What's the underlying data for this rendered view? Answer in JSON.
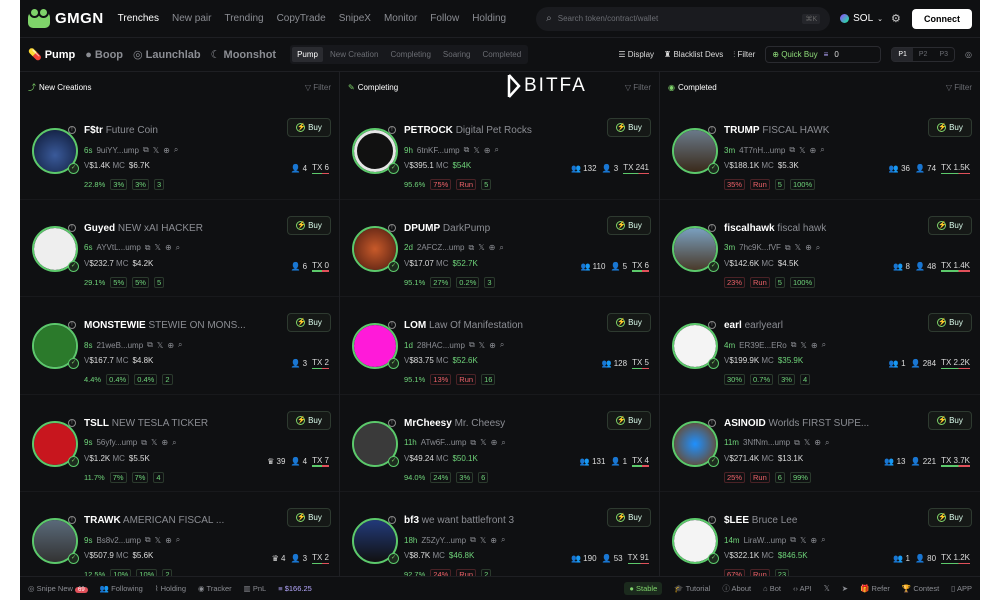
{
  "brand": {
    "name": "GMGN"
  },
  "nav": [
    "Trenches",
    "New pair",
    "Trending",
    "CopyTrade",
    "SnipeX",
    "Monitor",
    "Follow",
    "Holding"
  ],
  "search": {
    "placeholder": "Search token/contract/wallet",
    "shortcut": "⌘K"
  },
  "chain": {
    "name": "SOL"
  },
  "connect_label": "Connect",
  "platforms": [
    "Pump",
    "Boop",
    "Launchlab",
    "Moonshot"
  ],
  "stage_tabs": [
    "Pump",
    "New Creation",
    "Completing",
    "Soaring",
    "Completed"
  ],
  "toolbar": {
    "display": "Display",
    "blacklist": "Blacklist Devs",
    "filter": "Filter",
    "quick_buy": "Quick Buy",
    "quick_amount": "0",
    "presets": [
      "P1",
      "P2",
      "P3"
    ]
  },
  "watermark": "BITFA",
  "columns": [
    {
      "title": "New Creations",
      "filter": "Filter",
      "cards": [
        {
          "sym": "F$tr",
          "name": "Future Coin",
          "age": "6s",
          "addr": "9uiYY...ump",
          "v": "$1.4K",
          "mc": "$6.7K",
          "mc_hi": false,
          "stats": [
            "",
            "4",
            "6"
          ],
          "pct": "22.8%",
          "chips": [
            "3%",
            "3%",
            "3"
          ],
          "chip_red": false
        },
        {
          "sym": "Guyed",
          "name": "NEW xAI HACKER",
          "age": "6s",
          "addr": "AYVtL...ump",
          "v": "$232.7",
          "mc": "$4.2K",
          "mc_hi": false,
          "stats": [
            "",
            "6",
            "0"
          ],
          "pct": "29.1%",
          "chips": [
            "5%",
            "5%",
            "5"
          ],
          "chip_red": false
        },
        {
          "sym": "MONSTEWIE",
          "name": "STEWIE ON MONS...",
          "age": "8s",
          "addr": "21weB...ump",
          "v": "$167.7",
          "mc": "$4.8K",
          "mc_hi": false,
          "stats": [
            "",
            "3",
            "2"
          ],
          "pct": "4.4%",
          "chips": [
            "0.4%",
            "0.4%",
            "2"
          ],
          "chip_red": false
        },
        {
          "sym": "TSLL",
          "name": "NEW TESLA TICKER",
          "age": "9s",
          "addr": "56yfy...ump",
          "v": "$1.2K",
          "mc": "$5.5K",
          "mc_hi": false,
          "stats": [
            "39",
            "4",
            "7"
          ],
          "pct": "11.7%",
          "chips": [
            "7%",
            "7%",
            "4"
          ],
          "chip_red": false
        },
        {
          "sym": "TRAWK",
          "name": "AMERICAN FISCAL ...",
          "age": "9s",
          "addr": "Bs8v2...ump",
          "v": "$507.9",
          "mc": "$5.6K",
          "mc_hi": false,
          "stats": [
            "4",
            "3",
            "2"
          ],
          "pct": "12.5%",
          "chips": [
            "10%",
            "10%",
            "2"
          ],
          "chip_red": false
        }
      ]
    },
    {
      "title": "Completing",
      "filter": "Filter",
      "cards": [
        {
          "sym": "PETROCK",
          "name": "Digital Pet Rocks",
          "age": "9h",
          "addr": "6tnKF...ump",
          "v": "$395.1",
          "mc": "$54K",
          "mc_hi": true,
          "stats": [
            "132",
            "3",
            "241"
          ],
          "pct": "95.6%",
          "chips": [
            "75%",
            "Run",
            "5"
          ],
          "chip_red": true
        },
        {
          "sym": "DPUMP",
          "name": "DarkPump",
          "age": "2d",
          "addr": "2AFCZ...ump",
          "v": "$17.07",
          "mc": "$52.7K",
          "mc_hi": true,
          "stats": [
            "110",
            "5",
            "6"
          ],
          "pct": "95.1%",
          "chips": [
            "27%",
            "0.2%",
            "3"
          ],
          "chip_red": false
        },
        {
          "sym": "LOM",
          "name": "Law Of Manifestation",
          "age": "1d",
          "addr": "28HAC...ump",
          "v": "$83.75",
          "mc": "$52.6K",
          "mc_hi": true,
          "stats": [
            "128",
            "",
            "5"
          ],
          "pct": "95.1%",
          "chips": [
            "13%",
            "Run",
            "16"
          ],
          "chip_red": true
        },
        {
          "sym": "MrCheesy",
          "name": "Mr. Cheesy",
          "age": "11h",
          "addr": "ATw6F...ump",
          "v": "$49.24",
          "mc": "$50.1K",
          "mc_hi": true,
          "stats": [
            "131",
            "1",
            "4"
          ],
          "pct": "94.0%",
          "chips": [
            "24%",
            "3%",
            "6"
          ],
          "chip_red": false
        },
        {
          "sym": "bf3",
          "name": "we want battlefront 3",
          "age": "18h",
          "addr": "Z5ZyY...ump",
          "v": "$8.7K",
          "mc": "$46.8K",
          "mc_hi": true,
          "stats": [
            "190",
            "53",
            "91"
          ],
          "pct": "92.7%",
          "chips": [
            "24%",
            "Run",
            "2"
          ],
          "chip_red": true
        }
      ]
    },
    {
      "title": "Completed",
      "filter": "Filter",
      "cards": [
        {
          "sym": "TRUMP",
          "name": "FISCAL HAWK",
          "age": "3m",
          "addr": "4T7nH...ump",
          "v": "$188.1K",
          "mc": "$5.3K",
          "mc_hi": false,
          "stats": [
            "36",
            "74",
            "1.5K"
          ],
          "pct": "",
          "chips": [
            "35%",
            "Run",
            "5",
            "100%"
          ],
          "chip_red": true
        },
        {
          "sym": "fiscalhawk",
          "name": "fiscal hawk",
          "age": "3m",
          "addr": "7hc9K...fVF",
          "v": "$142.6K",
          "mc": "$4.5K",
          "mc_hi": false,
          "stats": [
            "8",
            "48",
            "1.4K"
          ],
          "pct": "",
          "chips": [
            "23%",
            "Run",
            "5",
            "100%"
          ],
          "chip_red": true
        },
        {
          "sym": "earl",
          "name": "earlyearl",
          "age": "4m",
          "addr": "ER39E...ERo",
          "v": "$199.9K",
          "mc": "$35.9K",
          "mc_hi": true,
          "stats": [
            "1",
            "284",
            "2.2K"
          ],
          "pct": "",
          "chips": [
            "30%",
            "0.7%",
            "3%",
            "4"
          ],
          "chip_red": false
        },
        {
          "sym": "ASINOID",
          "name": "Worlds FIRST SUPE...",
          "age": "11m",
          "addr": "3NfNm...ump",
          "v": "$271.4K",
          "mc": "$13.1K",
          "mc_hi": false,
          "stats": [
            "13",
            "221",
            "3.7K"
          ],
          "pct": "",
          "chips": [
            "25%",
            "Run",
            "6",
            "99%"
          ],
          "chip_red": true
        },
        {
          "sym": "$LEE",
          "name": "Bruce Lee",
          "age": "14m",
          "addr": "LiraW...ump",
          "v": "$322.1K",
          "mc": "$846.5K",
          "mc_hi": true,
          "stats": [
            "1",
            "80",
            "1.2K"
          ],
          "pct": "",
          "chips": [
            "67%",
            "Run",
            "23"
          ],
          "chip_red": true
        }
      ]
    }
  ],
  "bottombar": {
    "items": [
      "Snipe New",
      "Following",
      "Holding",
      "Tracker",
      "PnL"
    ],
    "badge": "69",
    "balance": "$166.25",
    "right": [
      "Stable",
      "Tutorial",
      "About",
      "Bot",
      "API",
      "Refer",
      "Contest",
      "APP"
    ]
  },
  "colors": {
    "accent": "#6fd47a",
    "danger": "#f0636a",
    "bg": "#0f1012"
  }
}
